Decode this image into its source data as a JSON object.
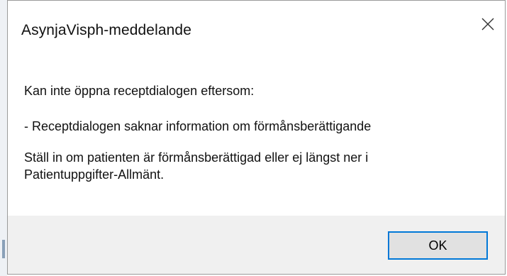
{
  "dialog": {
    "title": "AsynjaVisph-meddelande",
    "close_icon": "close-icon",
    "message": {
      "line1": "Kan inte öppna receptdialogen eftersom:",
      "line2": " - Receptdialogen saknar information om förmånsberättigande",
      "line3": "Ställ in om patienten är förmånsberättigad eller ej längst ner i",
      "line4": "Patientuppgifter-Allmänt."
    },
    "ok_label": "OK"
  },
  "colors": {
    "focus_border": "#0078d7",
    "footer_background": "#f0f0f0",
    "button_background": "#e1e1e1"
  }
}
